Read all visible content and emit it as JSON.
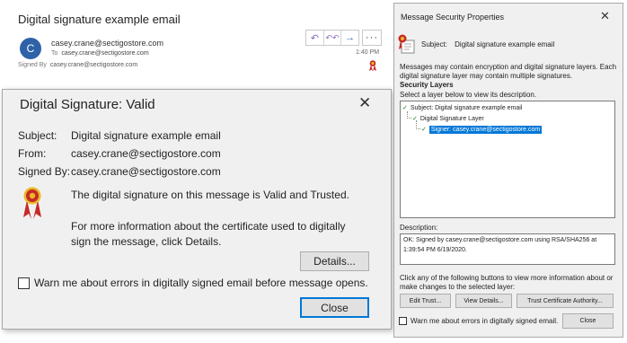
{
  "email": {
    "subject": "Digital signature example email",
    "avatar_initial": "C",
    "sender": "casey.crane@sectigostore.com",
    "to_label": "To",
    "to_value": "casey.crane@sectigostore.com",
    "signed_by_label": "Signed By",
    "signed_by_value": "casey.crane@sectigostore.com",
    "time": "1:40 PM",
    "actions": {
      "reply": "↶",
      "reply_all": "↶↶",
      "forward": "→",
      "more": "···"
    }
  },
  "signature_dialog": {
    "title": "Digital Signature: Valid",
    "close_glyph": "✕",
    "subject_label": "Subject:",
    "subject_value": "Digital signature example email",
    "from_label": "From:",
    "from_value": "casey.crane@sectigostore.com",
    "signed_by_label": "Signed By:",
    "signed_by_value": "casey.crane@sectigostore.com",
    "status_message": "The digital signature on this message is Valid and Trusted.",
    "info_line1": "For more information about the certificate used to digitally",
    "info_line2": "sign the message, click Details.",
    "details_button": "Details...",
    "warn_checkbox_label": "Warn me about errors in digitally signed email before message opens.",
    "warn_checked": false,
    "close_button": "Close"
  },
  "security_props": {
    "title": "Message Security Properties",
    "close_glyph": "✕",
    "subject_label": "Subject:",
    "subject_value": "Digital signature example email",
    "intro_line1": "Messages may contain encryption and digital signature layers. Each",
    "intro_line2": "digital signature layer may contain multiple signatures.",
    "layers_heading": "Security Layers",
    "select_prompt": "Select a layer below to view its description.",
    "tree": [
      {
        "label": "Subject: Digital signature example email",
        "level": 0,
        "checked": true,
        "selected": false
      },
      {
        "label": "Digital Signature Layer",
        "level": 1,
        "checked": true,
        "selected": false
      },
      {
        "label": "Signer: casey.crane@sectigostore.com",
        "level": 2,
        "checked": true,
        "selected": true
      }
    ],
    "description_label": "Description:",
    "description_line1": "OK: Signed by casey.crane@sectigostore.com using RSA/SHA256 at",
    "description_line2": "1:39:54 PM 6/19/2020.",
    "help_line1": "Click any of the following buttons to view more information about or",
    "help_line2": "make changes to the selected layer:",
    "edit_trust_button": "Edit Trust...",
    "view_details_button": "View Details...",
    "trust_ca_button": "Trust Certificate Authority...",
    "warn_checkbox_label": "Warn me about errors in digitally signed email.",
    "warn_checked": false,
    "close_button": "Close"
  },
  "colors": {
    "avatar_bg": "#2e62a8",
    "dialog_bg": "#f0f0f0",
    "selection": "#0078d7",
    "check_green": "#1b7a1b",
    "ribbon_red": "#c62828",
    "ribbon_gold": "#e8b923"
  }
}
